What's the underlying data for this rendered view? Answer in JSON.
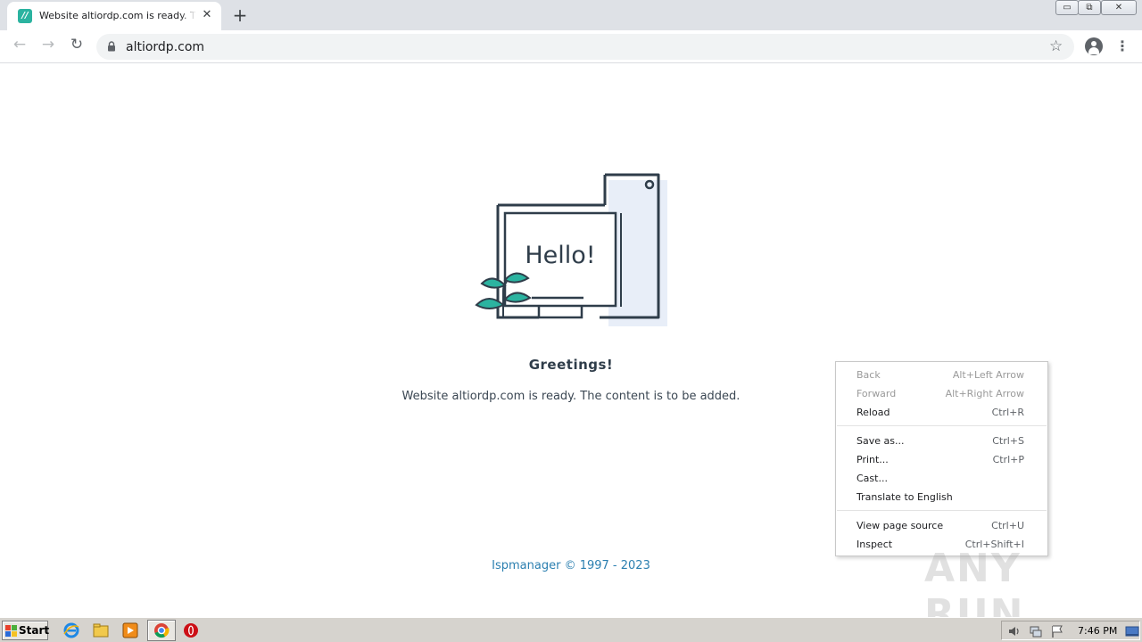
{
  "browser": {
    "tab": {
      "title": "Website altiordp.com is ready. The content is to be added.",
      "favicon": "ispmanager-favicon",
      "close_glyph": "✕"
    },
    "new_tab_glyph": "+",
    "window_controls": {
      "minimize": "▭",
      "restore": "⧉",
      "close": "✕"
    },
    "toolbar": {
      "back_glyph": "←",
      "forward_glyph": "→",
      "reload_glyph": "↻",
      "url": "altiordp.com",
      "bookmark_glyph": "☆",
      "menu_glyph": "⋮"
    }
  },
  "page": {
    "illustration_text": "Hello!",
    "heading": "Greetings!",
    "message": "Website altiordp.com is ready. The content is to be added.",
    "footer": "Ispmanager © 1997 - 2023"
  },
  "context_menu": {
    "items": [
      {
        "label": "Back",
        "shortcut": "Alt+Left Arrow",
        "enabled": false
      },
      {
        "label": "Forward",
        "shortcut": "Alt+Right Arrow",
        "enabled": false
      },
      {
        "label": "Reload",
        "shortcut": "Ctrl+R",
        "enabled": true
      },
      {
        "label": "Save as...",
        "shortcut": "Ctrl+S",
        "enabled": true
      },
      {
        "label": "Print...",
        "shortcut": "Ctrl+P",
        "enabled": true
      },
      {
        "label": "Cast...",
        "shortcut": "",
        "enabled": true
      },
      {
        "label": "Translate to English",
        "shortcut": "",
        "enabled": true
      },
      {
        "label": "View page source",
        "shortcut": "Ctrl+U",
        "enabled": true
      },
      {
        "label": "Inspect",
        "shortcut": "Ctrl+Shift+I",
        "enabled": true
      }
    ]
  },
  "watermark": "ANY RUN",
  "taskbar": {
    "start_label": "Start",
    "clock": "7:46 PM",
    "pinned": [
      "ie-icon",
      "explorer-icon",
      "media-player-icon",
      "chrome-icon",
      "opera-icon"
    ]
  },
  "colors": {
    "accent_teal": "#2bb3a0",
    "footer_link": "#2b7fb0",
    "illustration_stroke": "#2f3d4a",
    "illustration_fill": "#e8eef8"
  }
}
